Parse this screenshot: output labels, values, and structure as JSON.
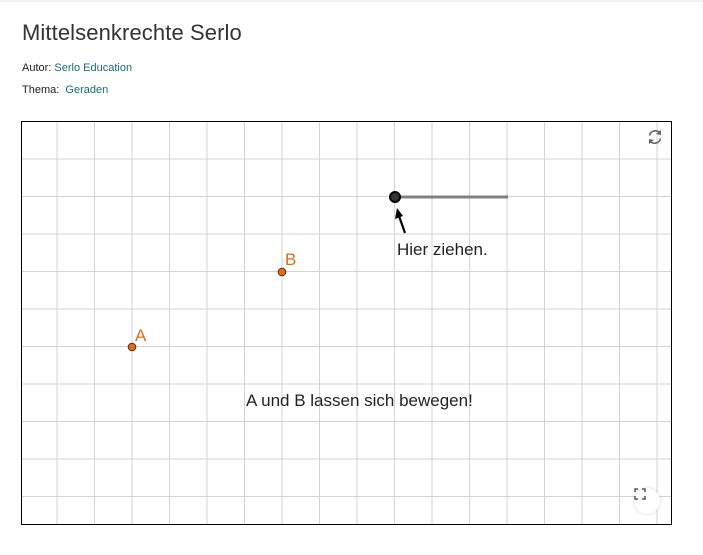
{
  "page": {
    "title": "Mittelsenkrechte Serlo",
    "author_label": "Autor:",
    "author_name": "Serlo Education",
    "topic_label": "Thema:",
    "topic_name": "Geraden"
  },
  "applet": {
    "points": [
      {
        "label": "A",
        "color": "#e06b1a"
      },
      {
        "label": "B",
        "color": "#e06b1a"
      }
    ],
    "slider_hint": "Hier ziehen.",
    "instruction": "A und B lassen sich bewegen!",
    "icons": {
      "reset": "reset-icon",
      "fullscreen": "fullscreen-icon"
    },
    "colors": {
      "grid": "#d3d3d3",
      "point": "#e06b1a",
      "slider_track": "#808080",
      "slider_handle": "#000000"
    }
  }
}
